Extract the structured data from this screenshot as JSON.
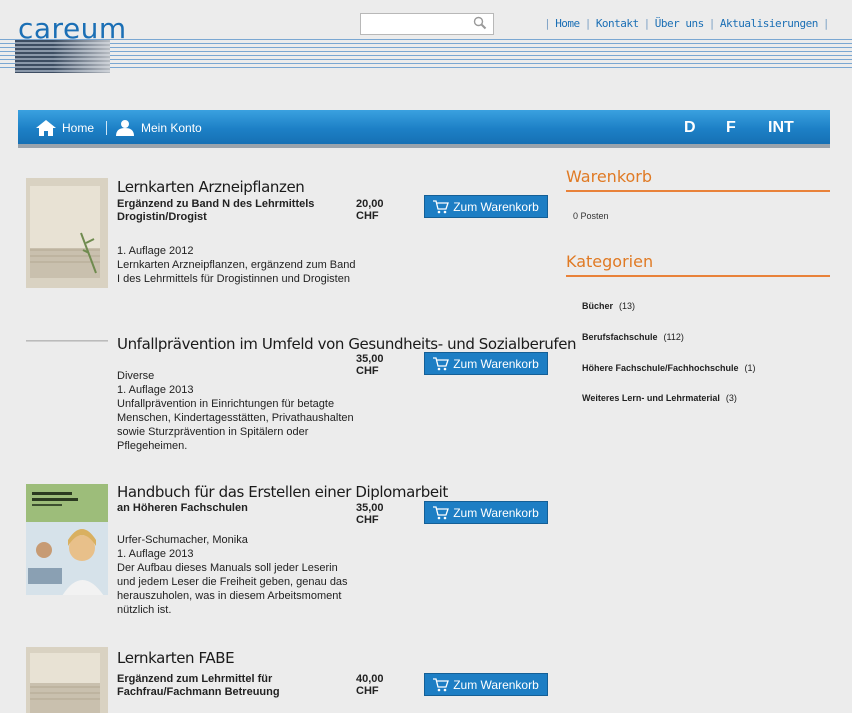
{
  "header": {
    "logo": "careum",
    "search_placeholder": "",
    "links": [
      "Home",
      "Kontakt",
      "Über uns",
      "Aktualisierungen"
    ]
  },
  "nav": {
    "home": "Home",
    "account": "Mein Konto",
    "languages": [
      "D",
      "F",
      "INT"
    ]
  },
  "products": [
    {
      "title": "Lernkarten Arzneipflanzen",
      "subtitle": "Ergänzend zu Band N des Lehrmittels Drogistin/Drogist",
      "price": "20,00 CHF",
      "button": "Zum Warenkorb",
      "desc": [
        "1. Auflage 2012",
        "Lernkarten Arzneipflanzen, ergänzend zum Band I des Lehrmittels für Drogistinnen und Drogisten"
      ]
    },
    {
      "title": "Unfallprävention im Umfeld von Gesundheits- und Sozialberufen",
      "subtitle": "",
      "price": "35,00 CHF",
      "button": "Zum Warenkorb",
      "desc": [
        "Diverse",
        "1. Auflage 2013",
        "Unfallprävention in Einrichtungen für betagte Menschen, Kindertagesstätten, Privathaushalten sowie Sturzprävention in Spitälern oder Pflegeheimen."
      ]
    },
    {
      "title": "Handbuch für das Erstellen einer Diplomarbeit",
      "subtitle": "an Höheren Fachschulen",
      "price": "35,00 CHF",
      "button": "Zum Warenkorb",
      "desc": [
        "Urfer-Schumacher, Monika",
        "1. Auflage 2013",
        "Der Aufbau dieses Manuals soll jeder Leserin und jedem Leser die Freiheit geben, genau das herauszuholen, was in diesem Arbeitsmoment nützlich ist."
      ]
    },
    {
      "title": "Lernkarten FABE",
      "subtitle": "Ergänzend zum Lehrmittel für Fachfrau/Fachmann Betreuung",
      "price": "40,00 CHF",
      "button": "Zum Warenkorb",
      "desc": []
    }
  ],
  "sidebar": {
    "cart_title": "Warenkorb",
    "cart_items": "0 Posten",
    "categories_title": "Kategorien",
    "categories": [
      {
        "name": "Bücher",
        "count": "(13)"
      },
      {
        "name": "Berufsfachschule",
        "count": "(112)"
      },
      {
        "name": "Höhere Fachschule/Fachhochschule",
        "count": "(1)"
      },
      {
        "name": "Weiteres Lern- und Lehrmaterial",
        "count": "(3)"
      }
    ]
  },
  "colors": {
    "brand_blue": "#1b6fb5",
    "nav_blue": "#1d80c6",
    "accent_orange": "#e07a24"
  }
}
